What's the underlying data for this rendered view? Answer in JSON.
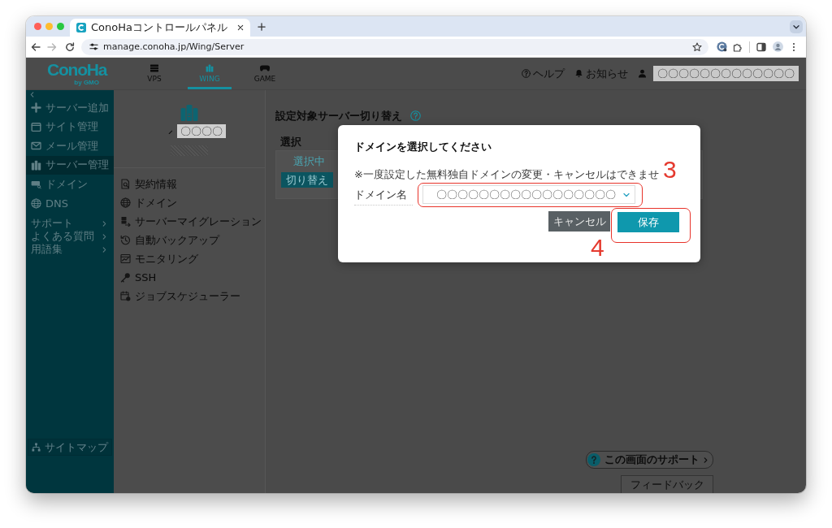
{
  "browser": {
    "tab_title": "ConoHaコントロールパネル",
    "url": "manage.conoha.jp/Wing/Server",
    "forward_enabled": false
  },
  "header": {
    "logo": "ConoHa",
    "logo_sub": "by GMO",
    "nav": [
      {
        "label": "VPS",
        "selected": false
      },
      {
        "label": "WING",
        "selected": true
      },
      {
        "label": "GAME",
        "selected": false
      }
    ],
    "help": "ヘルプ",
    "notices": "お知らせ",
    "user": "〇〇〇〇〇〇〇〇〇〇〇〇〇"
  },
  "sidebar": {
    "items": [
      {
        "label": "サーバー追加",
        "selected": false
      },
      {
        "label": "サイト管理",
        "selected": false
      },
      {
        "label": "メール管理",
        "selected": false
      },
      {
        "label": "サーバー管理",
        "selected": true
      },
      {
        "label": "ドメイン",
        "selected": false
      },
      {
        "label": "DNS",
        "selected": false
      }
    ],
    "links": [
      "サポート",
      "よくある質問",
      "用語集"
    ],
    "sitemap": "サイトマップ"
  },
  "server_panel": {
    "name": "〇〇〇〇",
    "menu": [
      "契約情報",
      "ドメイン",
      "サーバーマイグレーション",
      "自動バックアップ",
      "モニタリング",
      "SSH",
      "ジョブスケジューラー"
    ]
  },
  "main": {
    "title": "設定対象サーバー切り替え",
    "table": {
      "columns": [
        "選択"
      ],
      "rows": [
        {
          "status": "選択中",
          "action": "切り替え"
        }
      ]
    }
  },
  "support": "この画面のサポート",
  "feedback": "フィードバック",
  "dialog": {
    "title": "ドメインを選択してください",
    "note": "※一度設定した無料独自ドメインの変更・キャンセルはできませ",
    "note_callout": "3",
    "field": {
      "label": "ドメイン名",
      "value": "〇〇〇〇〇〇〇〇〇〇〇〇〇〇〇〇〇",
      "highlighted": true
    },
    "buttons": [
      {
        "label": "キャンセル",
        "kind": "secondary",
        "highlighted": false
      },
      {
        "label": "保存",
        "kind": "primary",
        "highlighted": true,
        "callout": "4"
      }
    ]
  }
}
